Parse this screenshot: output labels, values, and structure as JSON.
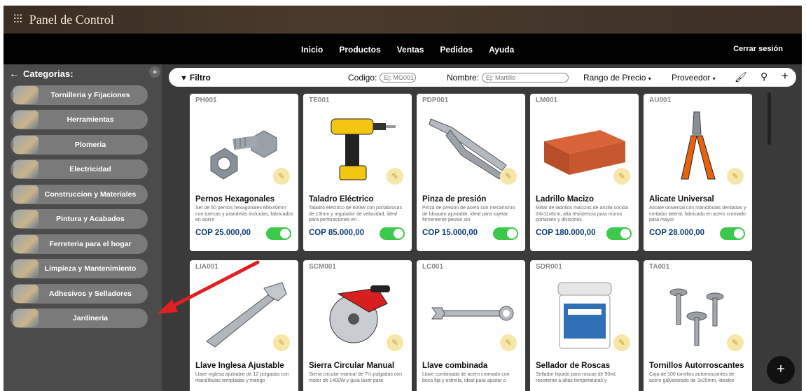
{
  "app": {
    "title": "Panel de Control",
    "logo_icon": "sliders-icon"
  },
  "nav": {
    "links": [
      "Inicio",
      "Productos",
      "Ventas",
      "Pedidos",
      "Ayuda"
    ],
    "logout": "Cerrar sesión"
  },
  "sidebar": {
    "title": "Categorias:",
    "categories": [
      "Tornilleria y Fijaciones",
      "Herramientas",
      "Plomeria",
      "Electricidad",
      "Construccion y Materiales",
      "Pintura y Acabados",
      "Ferreteria para el hogar",
      "Limpieza y Mantenimiento",
      "Adhesivos y Selladores",
      "Jardineria"
    ]
  },
  "filter": {
    "label": "Filtro",
    "code_label": "Codigo:",
    "code_placeholder": "Ej: MG001",
    "name_label": "Nombre:",
    "name_placeholder": "Ej: Martillo",
    "price_range": "Rango de Precio",
    "supplier": "Proveedor"
  },
  "products": [
    {
      "code": "PH001",
      "name": "Pernos Hexagonales",
      "desc": "Set de 50 pernos hexagonales M8x40mm con tuercas y arandelas incluidas, fabricados en acero",
      "price": "COP 25.000,00",
      "active": true
    },
    {
      "code": "TE001",
      "name": "Taladro Eléctrico",
      "desc": "Taladro eléctrico de 600W con portabrocas de 13mm y regulador de velocidad, ideal para perforaciones en",
      "price": "COP 85.000,00",
      "active": true
    },
    {
      "code": "PDP001",
      "name": "Pinza de presión",
      "desc": "Pinza de presión de acero con mecanismo de bloqueo ajustable, ideal para sujetar firmemente piezas sin",
      "price": "COP 15.000,00",
      "active": true
    },
    {
      "code": "LM001",
      "name": "Ladrillo Macizo",
      "desc": "Millar de ladrillos macizos de arcilla cocida 24x11x6cm, alta resistencia para muros portantes y divisorios.",
      "price": "COP 180.000,00",
      "active": true
    },
    {
      "code": "AU001",
      "name": "Alicate Universal",
      "desc": "Alicate universal con mandíbulas dentadas y cortador lateral, fabricado en acero cromado para mayor",
      "price": "COP 28.000,00",
      "active": true
    },
    {
      "code": "LIA001",
      "name": "Llave Inglesa Ajustable",
      "desc": "Llave inglesa ajustable de 12 pulgadas con mandíbulas templadas y mango",
      "price": "",
      "active": true
    },
    {
      "code": "SCM001",
      "name": "Sierra Circular Manual",
      "desc": "Sierra circular manual de 7¼ pulgadas con motor de 1400W y guía láser para",
      "price": "",
      "active": true
    },
    {
      "code": "LC001",
      "name": "Llave combinada",
      "desc": "Llave combinada de acero cromado con boca fija y estrella, ideal para ajustar o",
      "price": "",
      "active": true
    },
    {
      "code": "SDR001",
      "name": "Sellador de Roscas",
      "desc": "Sellador líquido para roscas de 50ml, resistente a altas temperaturas y",
      "price": "",
      "active": true
    },
    {
      "code": "TA001",
      "name": "Tornillos Autorroscantes",
      "desc": "Caja de 100 tornillos autorroscantes de acero galvanizado de 3x25mm, ideales",
      "price": "",
      "active": true
    }
  ],
  "colors": {
    "toggle_on": "#3cc84a",
    "price": "#0b3a7a",
    "annotation_arrow": "#e02020"
  }
}
